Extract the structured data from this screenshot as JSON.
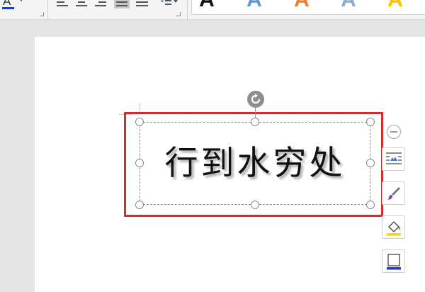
{
  "toolbar": {
    "font_color": {
      "icon": "font-color-icon",
      "glyph": "A",
      "color": "#1a39d6"
    },
    "paragraph_buttons": [
      {
        "name": "align-left",
        "active": false
      },
      {
        "name": "align-center",
        "active": false
      },
      {
        "name": "align-right",
        "active": false
      },
      {
        "name": "justify",
        "active": true
      },
      {
        "name": "distributed",
        "active": false
      },
      {
        "name": "line-spacing",
        "active": false
      }
    ],
    "wordart_styles": [
      {
        "glyph": "A",
        "color": "#111111"
      },
      {
        "glyph": "A",
        "color": "#5b9bd5"
      },
      {
        "glyph": "A",
        "color": "#ed7d31"
      },
      {
        "glyph": "A",
        "color": "#8fa9cc"
      },
      {
        "glyph": "A",
        "color": "#ffc000"
      }
    ]
  },
  "document": {
    "wordart_text": "行到水穷处",
    "highlight_color": "#d72a2a"
  },
  "side_tools": [
    {
      "name": "layout-options",
      "icon": "text-wrap-icon"
    },
    {
      "name": "shape-style",
      "icon": "paintbrush-icon"
    },
    {
      "name": "shape-fill",
      "icon": "fill-bucket-icon"
    },
    {
      "name": "shape-outline",
      "icon": "outline-icon"
    }
  ]
}
